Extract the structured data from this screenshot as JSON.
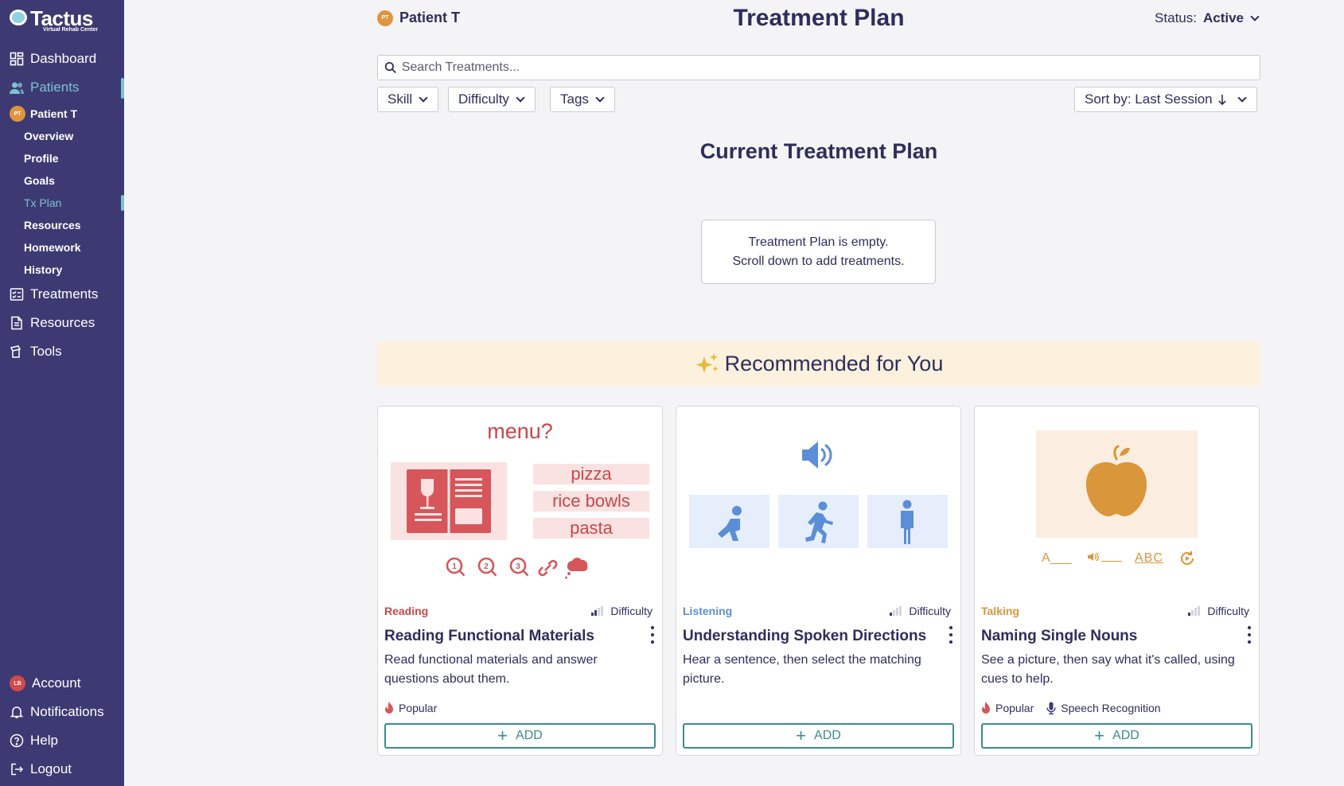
{
  "sidebar": {
    "logo": {
      "word": "Tactus",
      "subtitle": "Virtual Rehab Center"
    },
    "nav": {
      "dashboard": "Dashboard",
      "patients": "Patients",
      "patient_name": "Patient T",
      "patient_initials": "PT",
      "sub_items": [
        "Overview",
        "Profile",
        "Goals",
        "Tx Plan",
        "Resources",
        "Homework",
        "History"
      ],
      "treatments": "Treatments",
      "resources": "Resources",
      "tools": "Tools"
    },
    "bottom": {
      "account": "Account",
      "account_initials": "LB",
      "notifications": "Notifications",
      "help": "Help",
      "logout": "Logout"
    }
  },
  "header": {
    "patient_initials": "PT",
    "patient_name": "Patient T",
    "title": "Treatment Plan",
    "status_label": "Status:",
    "status_value": "Active"
  },
  "search": {
    "placeholder": "Search Treatments..."
  },
  "filters": {
    "skill": "Skill",
    "difficulty": "Difficulty",
    "tags": "Tags",
    "sort": "Sort by: Last Session"
  },
  "current_plan": {
    "title": "Current Treatment Plan",
    "empty_line1": "Treatment Plan is empty.",
    "empty_line2": "Scroll down to add treatments."
  },
  "recommended": {
    "title": "Recommended for You",
    "cards": [
      {
        "skill": "Reading",
        "skill_color": "#c9474a",
        "difficulty_label": "Difficulty",
        "difficulty_level": 2,
        "name": "Reading Functional Materials",
        "description": "Read functional materials and answer questions about them.",
        "tags": [
          "Popular"
        ],
        "add_label": "ADD",
        "art": {
          "question": "menu?",
          "options": [
            "pizza",
            "rice bowls",
            "pasta"
          ]
        }
      },
      {
        "skill": "Listening",
        "skill_color": "#5b8ed6",
        "difficulty_label": "Difficulty",
        "difficulty_level": 1,
        "name": "Understanding Spoken Directions",
        "description": "Hear a sentence, then select the matching picture.",
        "tags": [],
        "add_label": "ADD"
      },
      {
        "skill": "Talking",
        "skill_color": "#d9963a",
        "difficulty_label": "Difficulty",
        "difficulty_level": 1,
        "name": "Naming Single Nouns",
        "description": "See a picture, then say what it's called, using cues to help.",
        "tags": [
          "Popular",
          "Speech Recognition"
        ],
        "add_label": "ADD",
        "art": {
          "cues": [
            "A___",
            "ABC"
          ]
        }
      }
    ]
  }
}
